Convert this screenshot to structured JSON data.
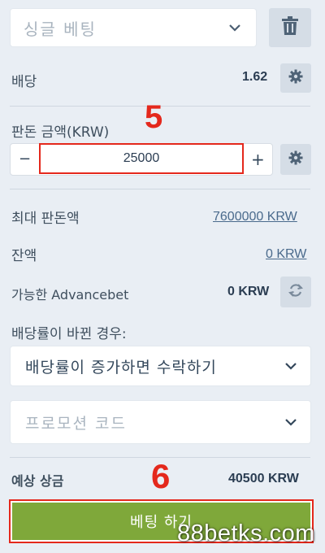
{
  "bet_type": {
    "selected": "싱글 베팅"
  },
  "odds": {
    "label": "배당",
    "value": "1.62"
  },
  "stake": {
    "label": "판돈 금액(KRW)",
    "value": "25000",
    "minus": "−",
    "plus": "+",
    "step_number": "5"
  },
  "max_stake": {
    "label": "최대 판돈액",
    "value": "7600000 KRW"
  },
  "balance": {
    "label": "잔액",
    "value": "0 KRW"
  },
  "advancebet": {
    "label": "가능한 Advancebet",
    "value": "0 KRW"
  },
  "odds_change": {
    "label": "배당률이 바뀐 경우:",
    "selected": "배당률이 증가하면 수락하기"
  },
  "promo": {
    "placeholder": "프로모션 코드"
  },
  "expected_win": {
    "label": "예상 상금",
    "value": "40500 KRW",
    "step_number": "6"
  },
  "place_bet": {
    "label": "베팅 하기"
  },
  "watermark": "88betks.com",
  "colors": {
    "background": "#e9eef4",
    "button_green": "#7fa83a",
    "highlight_red": "#e4281c"
  }
}
